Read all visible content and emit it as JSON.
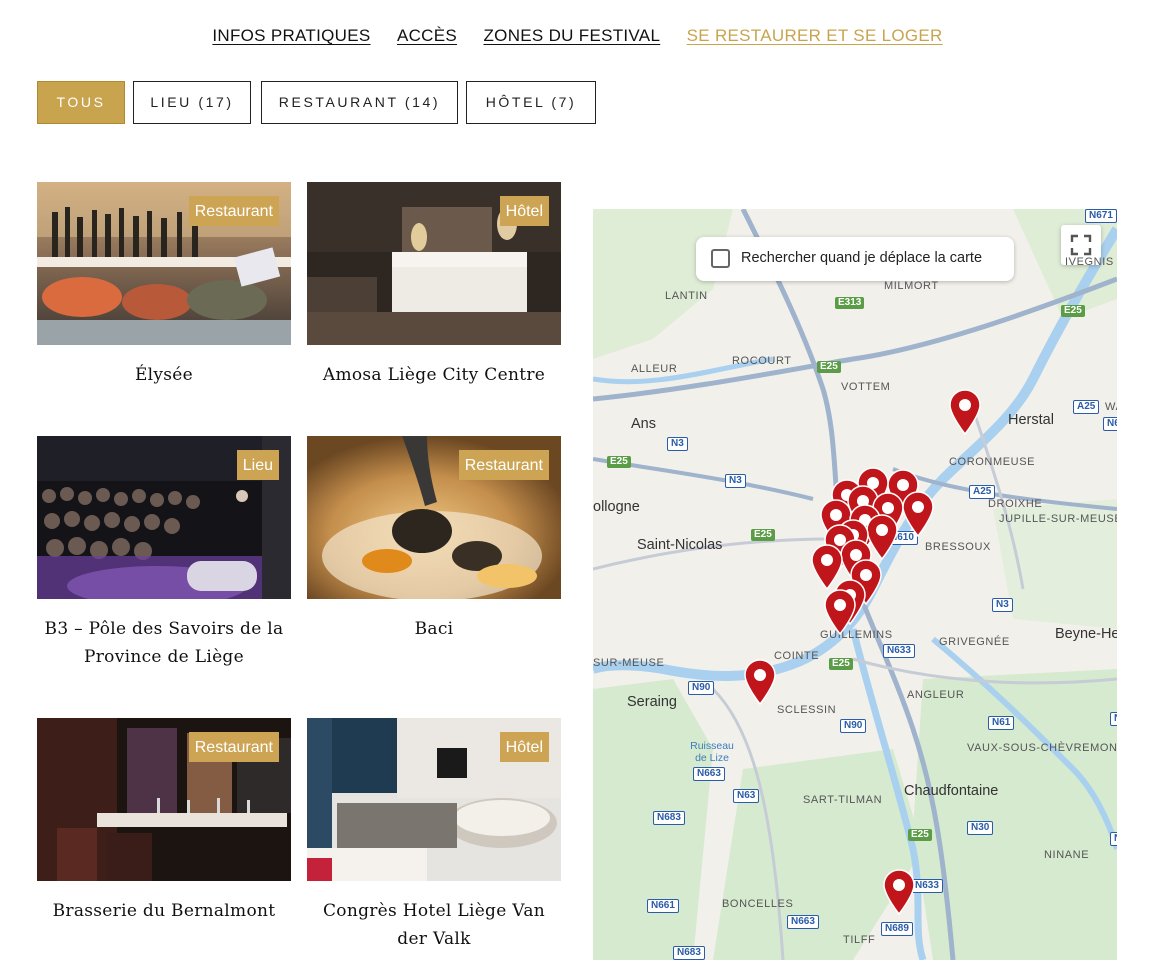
{
  "nav": {
    "items": [
      {
        "label": "INFOS PRATIQUES"
      },
      {
        "label": "ACCÈS"
      },
      {
        "label": "ZONES DU FESTIVAL"
      },
      {
        "label": "SE RESTAURER ET SE LOGER"
      }
    ],
    "active_index": 3
  },
  "filters": [
    {
      "label": "TOUS",
      "active": true
    },
    {
      "label": "LIEU (17)",
      "active": false
    },
    {
      "label": "RESTAURANT (14)",
      "active": false
    },
    {
      "label": "HÔTEL (7)",
      "active": false
    }
  ],
  "cards": [
    {
      "title": "Élysée",
      "badge": "Restaurant"
    },
    {
      "title": "Amosa Liège City Centre",
      "badge": "Hôtel"
    },
    {
      "title": "B3 – Pôle des Savoirs de la Province de Liège",
      "badge": "Lieu"
    },
    {
      "title": "Baci",
      "badge": "Restaurant"
    },
    {
      "title": "Brasserie du Bernalmont",
      "badge": "Restaurant"
    },
    {
      "title": "Congrès Hotel Liège Van der Valk",
      "badge": "Hôtel"
    }
  ],
  "map": {
    "search_toggle_label": "Rechercher quand je déplace la carte",
    "fullscreen_icon": "fullscreen-icon",
    "pin_color": "#c0161b",
    "places": {
      "lantin": "LANTIN",
      "milmort": "MILMORT",
      "rocourt": "ROCOURT",
      "alleur": "ALLEUR",
      "vottem": "VOTTEM",
      "ans": "Ans",
      "herstal": "Herstal",
      "coronmeuse": "CORONMEUSE",
      "droixhe": "DROIXHE",
      "jupille": "JUPILLE-SUR-MEUSE",
      "ollogne": "ollogne",
      "saint_nicolas": "Saint-Nicolas",
      "bressoux": "BRESSOUX",
      "guillemins": "GUILLEMINS",
      "grivegnee": "GRIVEGNÉE",
      "beyne": "Beyne-He",
      "sur_meuse": "SUR-MEUSE",
      "cointe": "COINTE",
      "seraing": "Seraing",
      "sclessin": "SCLESSIN",
      "angleur": "ANGLEUR",
      "ruisseau": "Ruisseau de Lize",
      "vaux": "VAUX-SOUS-CHÈVREMONT",
      "sart_tilman": "SART-TILMAN",
      "chaudfontaine": "Chaudfontaine",
      "ninane": "NINANE",
      "boncelles": "BONCELLES",
      "tilff": "TILFF",
      "vivegnis": "IVEGNIS",
      "wa": "WA"
    },
    "roads": {
      "n671": "N671",
      "e313": "E313",
      "e25_a": "E25",
      "e25_b": "E25",
      "e25_c": "E25",
      "e25_d": "E25",
      "e25_e": "E25",
      "e25_f": "E25",
      "a25_a": "A25",
      "a25_b": "A25",
      "n3_a": "N3",
      "n3_b": "N3",
      "n3_c": "N3",
      "n610": "N610",
      "n633_a": "N633",
      "n633_b": "N633",
      "n90_a": "N90",
      "n90_b": "N90",
      "n61": "N61",
      "n663": "N663",
      "n63": "N63",
      "n683": "N683",
      "n683_b": "N683",
      "n30": "N30",
      "n661": "N661",
      "n663_b": "N663",
      "n689": "N689",
      "n6": "N6",
      "n_right1": "N",
      "n_right2": "N"
    }
  }
}
